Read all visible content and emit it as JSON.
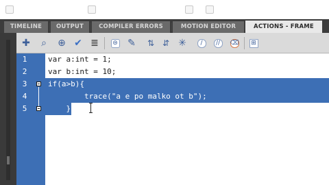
{
  "tabs": [
    {
      "label": "TIMELINE",
      "active": false
    },
    {
      "label": "OUTPUT",
      "active": false
    },
    {
      "label": "COMPILER ERRORS",
      "active": false
    },
    {
      "label": "MOTION EDITOR",
      "active": false
    },
    {
      "label": "ACTIONS - FRAME",
      "active": true
    }
  ],
  "toolbar": {
    "icons": [
      "add-statement-icon",
      "find-icon",
      "insert-target-path-icon",
      "check-syntax-icon",
      "auto-format-icon",
      "show-code-hint-icon",
      "debug-options-icon",
      "collapse-between-braces-icon",
      "collapse-selection-icon",
      "expand-all-icon",
      "apply-block-comment-icon",
      "apply-line-comment-icon",
      "remove-comment-icon",
      "show-hide-toolbox-icon",
      "code-snippets-icon"
    ]
  },
  "editor": {
    "lines": [
      {
        "number": "1",
        "text": "var a:int = 1;"
      },
      {
        "number": "2",
        "text": "var b:int = 10;"
      },
      {
        "number": "3",
        "text": "if(a>b){"
      },
      {
        "number": "4",
        "text": "        trace(\"a e po malko ot b\");"
      },
      {
        "number": "5",
        "text": "    }"
      }
    ],
    "selection_color": "#3d6fb5",
    "gutter_color": "#3d6fb5"
  }
}
